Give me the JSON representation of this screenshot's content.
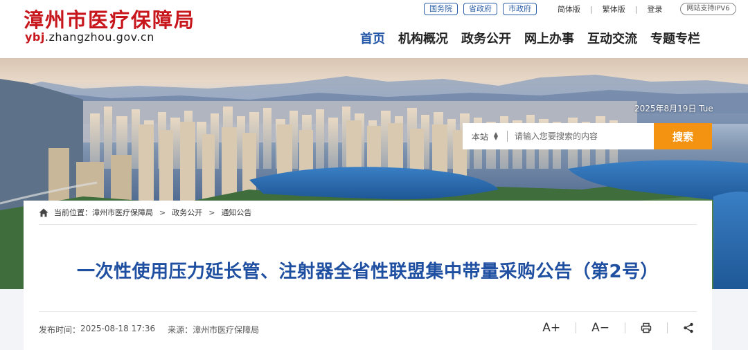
{
  "header": {
    "site_name": "漳州市医疗保障局",
    "domain_prefix": "ybj",
    "domain_rest": ".zhangzhou.gov.cn",
    "gov_links": [
      "国务院",
      "省政府",
      "市政府"
    ],
    "simplified": "简体版",
    "separator": "|",
    "traditional": "繁体版",
    "login": "登录",
    "ipv6": "网站支持IPV6",
    "nav": [
      "首页",
      "机构概况",
      "政务公开",
      "网上办事",
      "互动交流",
      "专题专栏"
    ],
    "active_nav_index": 0,
    "brand_color": "#c8161d",
    "nav_active_color": "#2357a5"
  },
  "banner": {
    "date_text": "2025年8月19日 Tue"
  },
  "search": {
    "scope": "本站",
    "placeholder": "请输入您要搜索的内容",
    "button_label": "搜索",
    "button_color": "#f49211"
  },
  "breadcrumb": {
    "prefix": "当前位置：",
    "items": [
      "漳州市医疗保障局",
      "政务公开",
      "通知公告"
    ],
    "separator": ">"
  },
  "article": {
    "title": "一次性使用压力延长管、注射器全省性联盟集中带量采购公告（第2号）",
    "publish_label": "发布时间：",
    "publish_time": "2025-08-18 17:36",
    "source_label": "来源：",
    "source": "漳州市医疗保障局",
    "title_color": "#1f4fa0"
  },
  "tools": {
    "font_increase": "A+",
    "font_decrease": "A−",
    "icons": [
      "print-icon",
      "share-icon"
    ]
  }
}
